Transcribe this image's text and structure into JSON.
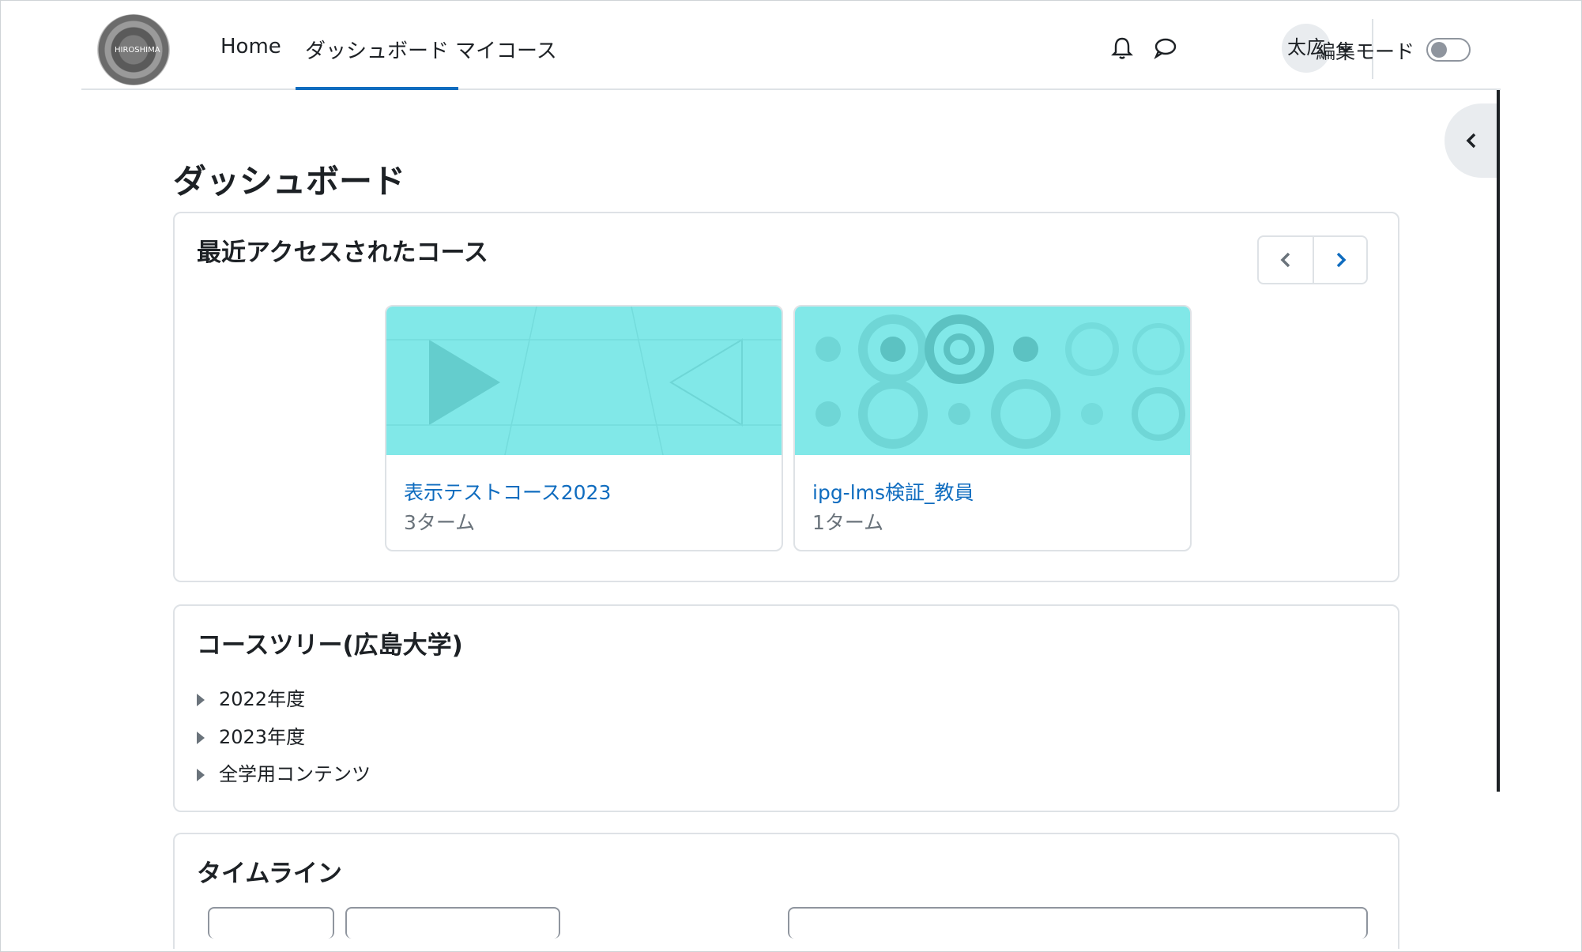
{
  "navbar": {
    "logo_text": "HIROSHIMA",
    "links": [
      {
        "label": "Home"
      },
      {
        "label": "ダッシュボード"
      },
      {
        "label": "マイコース"
      }
    ],
    "avatar_initials": "太広",
    "edit_mode_label": "編集モード"
  },
  "main": {
    "page_title": "ダッシュボード",
    "recent_courses": {
      "title": "最近アクセスされたコース",
      "courses": [
        {
          "name": "表示テストコース2023",
          "term": "3ターム"
        },
        {
          "name": "ipg-lms検証_教員",
          "term": "1ターム"
        }
      ]
    },
    "course_tree": {
      "title": "コースツリー(広島大学)",
      "items": [
        {
          "label": "2022年度"
        },
        {
          "label": "2023年度"
        },
        {
          "label": "全学用コンテンツ"
        }
      ]
    },
    "timeline": {
      "title": "タイムライン"
    }
  },
  "colors": {
    "accent": "#0f6cbf",
    "course_image_bg": "#81e8e8",
    "border": "#dee2e6"
  },
  "icons": [
    "bell-icon",
    "chat-icon",
    "chevron-down-icon",
    "chevron-left-icon",
    "chevron-right-icon",
    "triangle-right-icon"
  ]
}
